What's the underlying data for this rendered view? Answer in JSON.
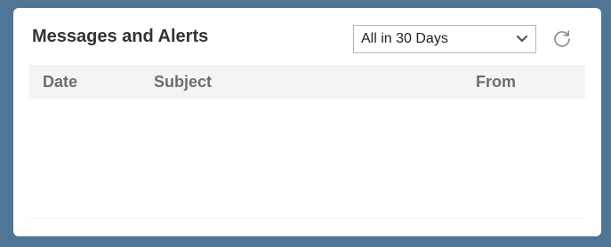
{
  "widget": {
    "title": "Messages and Alerts",
    "filter": {
      "selected": "All in 30 Days"
    },
    "refresh_icon": "refresh-icon",
    "table": {
      "columns": [
        "Date",
        "Subject",
        "From"
      ],
      "rows": []
    }
  },
  "colors": {
    "page_background": "#4f7597",
    "card_background": "#ffffff",
    "header_background": "#f4f4f4",
    "header_text": "#6d6d6d",
    "title_text": "#333333"
  }
}
